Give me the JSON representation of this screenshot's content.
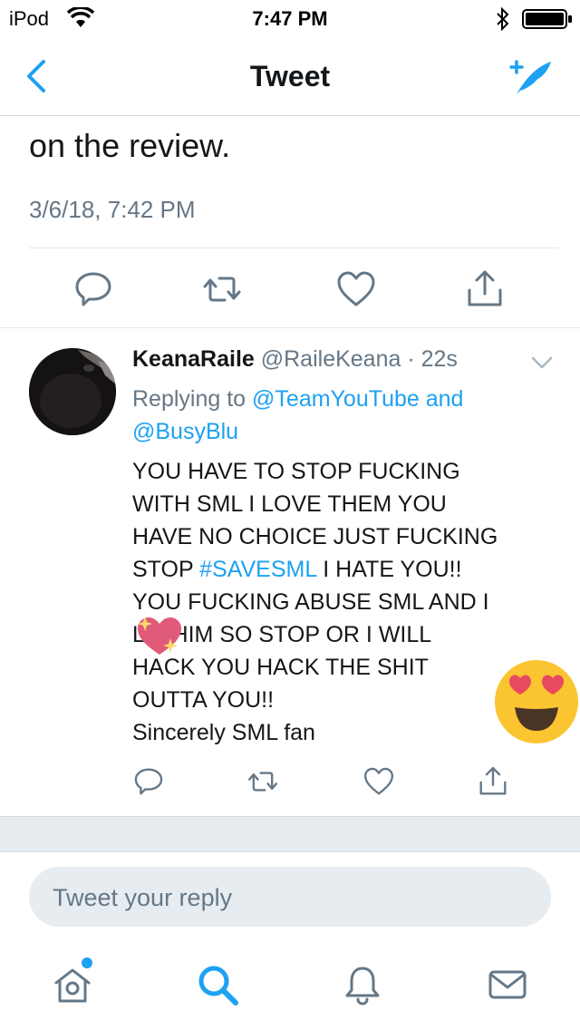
{
  "status_bar": {
    "carrier": "iPod",
    "time": "7:47 PM"
  },
  "nav": {
    "title": "Tweet"
  },
  "main_tweet": {
    "text_tail": "on the review.",
    "timestamp": "3/6/18, 7:42 PM"
  },
  "reply": {
    "name": "KeanaRaile",
    "handle": "@RaileKeana",
    "separator": " · ",
    "age": "22s",
    "replying_prefix": "Replying to ",
    "replying_user1": "@TeamYouTube",
    "replying_and": " and",
    "replying_user2": "@BusyBlu",
    "body_part1": "YOU HAVE TO STOP FUCKING\nWITH SML I LOVE THEM YOU\nHAVE NO CHOICE JUST FUCKING\nSTOP ",
    "hashtag": "#SAVESML",
    "body_part2": " I HATE YOU!!\nYOU FUCKING ABUSE SML AND I\nL   E HIM SO STOP OR I WILL\nHACK YOU HACK THE SHIT\nOUTTA YOU!!\nSincerely SML fan"
  },
  "composer": {
    "placeholder": "Tweet your reply"
  },
  "colors": {
    "accent": "#1da1f2",
    "secondary_text": "#657786",
    "background_band": "#e6ecf0"
  },
  "icons": {
    "nav_back": "chevron-left-icon",
    "nav_compose": "compose-feather-icon",
    "reply": "reply-bubble-icon",
    "retweet": "retweet-icon",
    "like": "heart-icon",
    "share": "share-icon",
    "tab_home": "home-icon",
    "tab_search": "search-icon",
    "tab_notifications": "bell-icon",
    "tab_messages": "mail-icon"
  }
}
